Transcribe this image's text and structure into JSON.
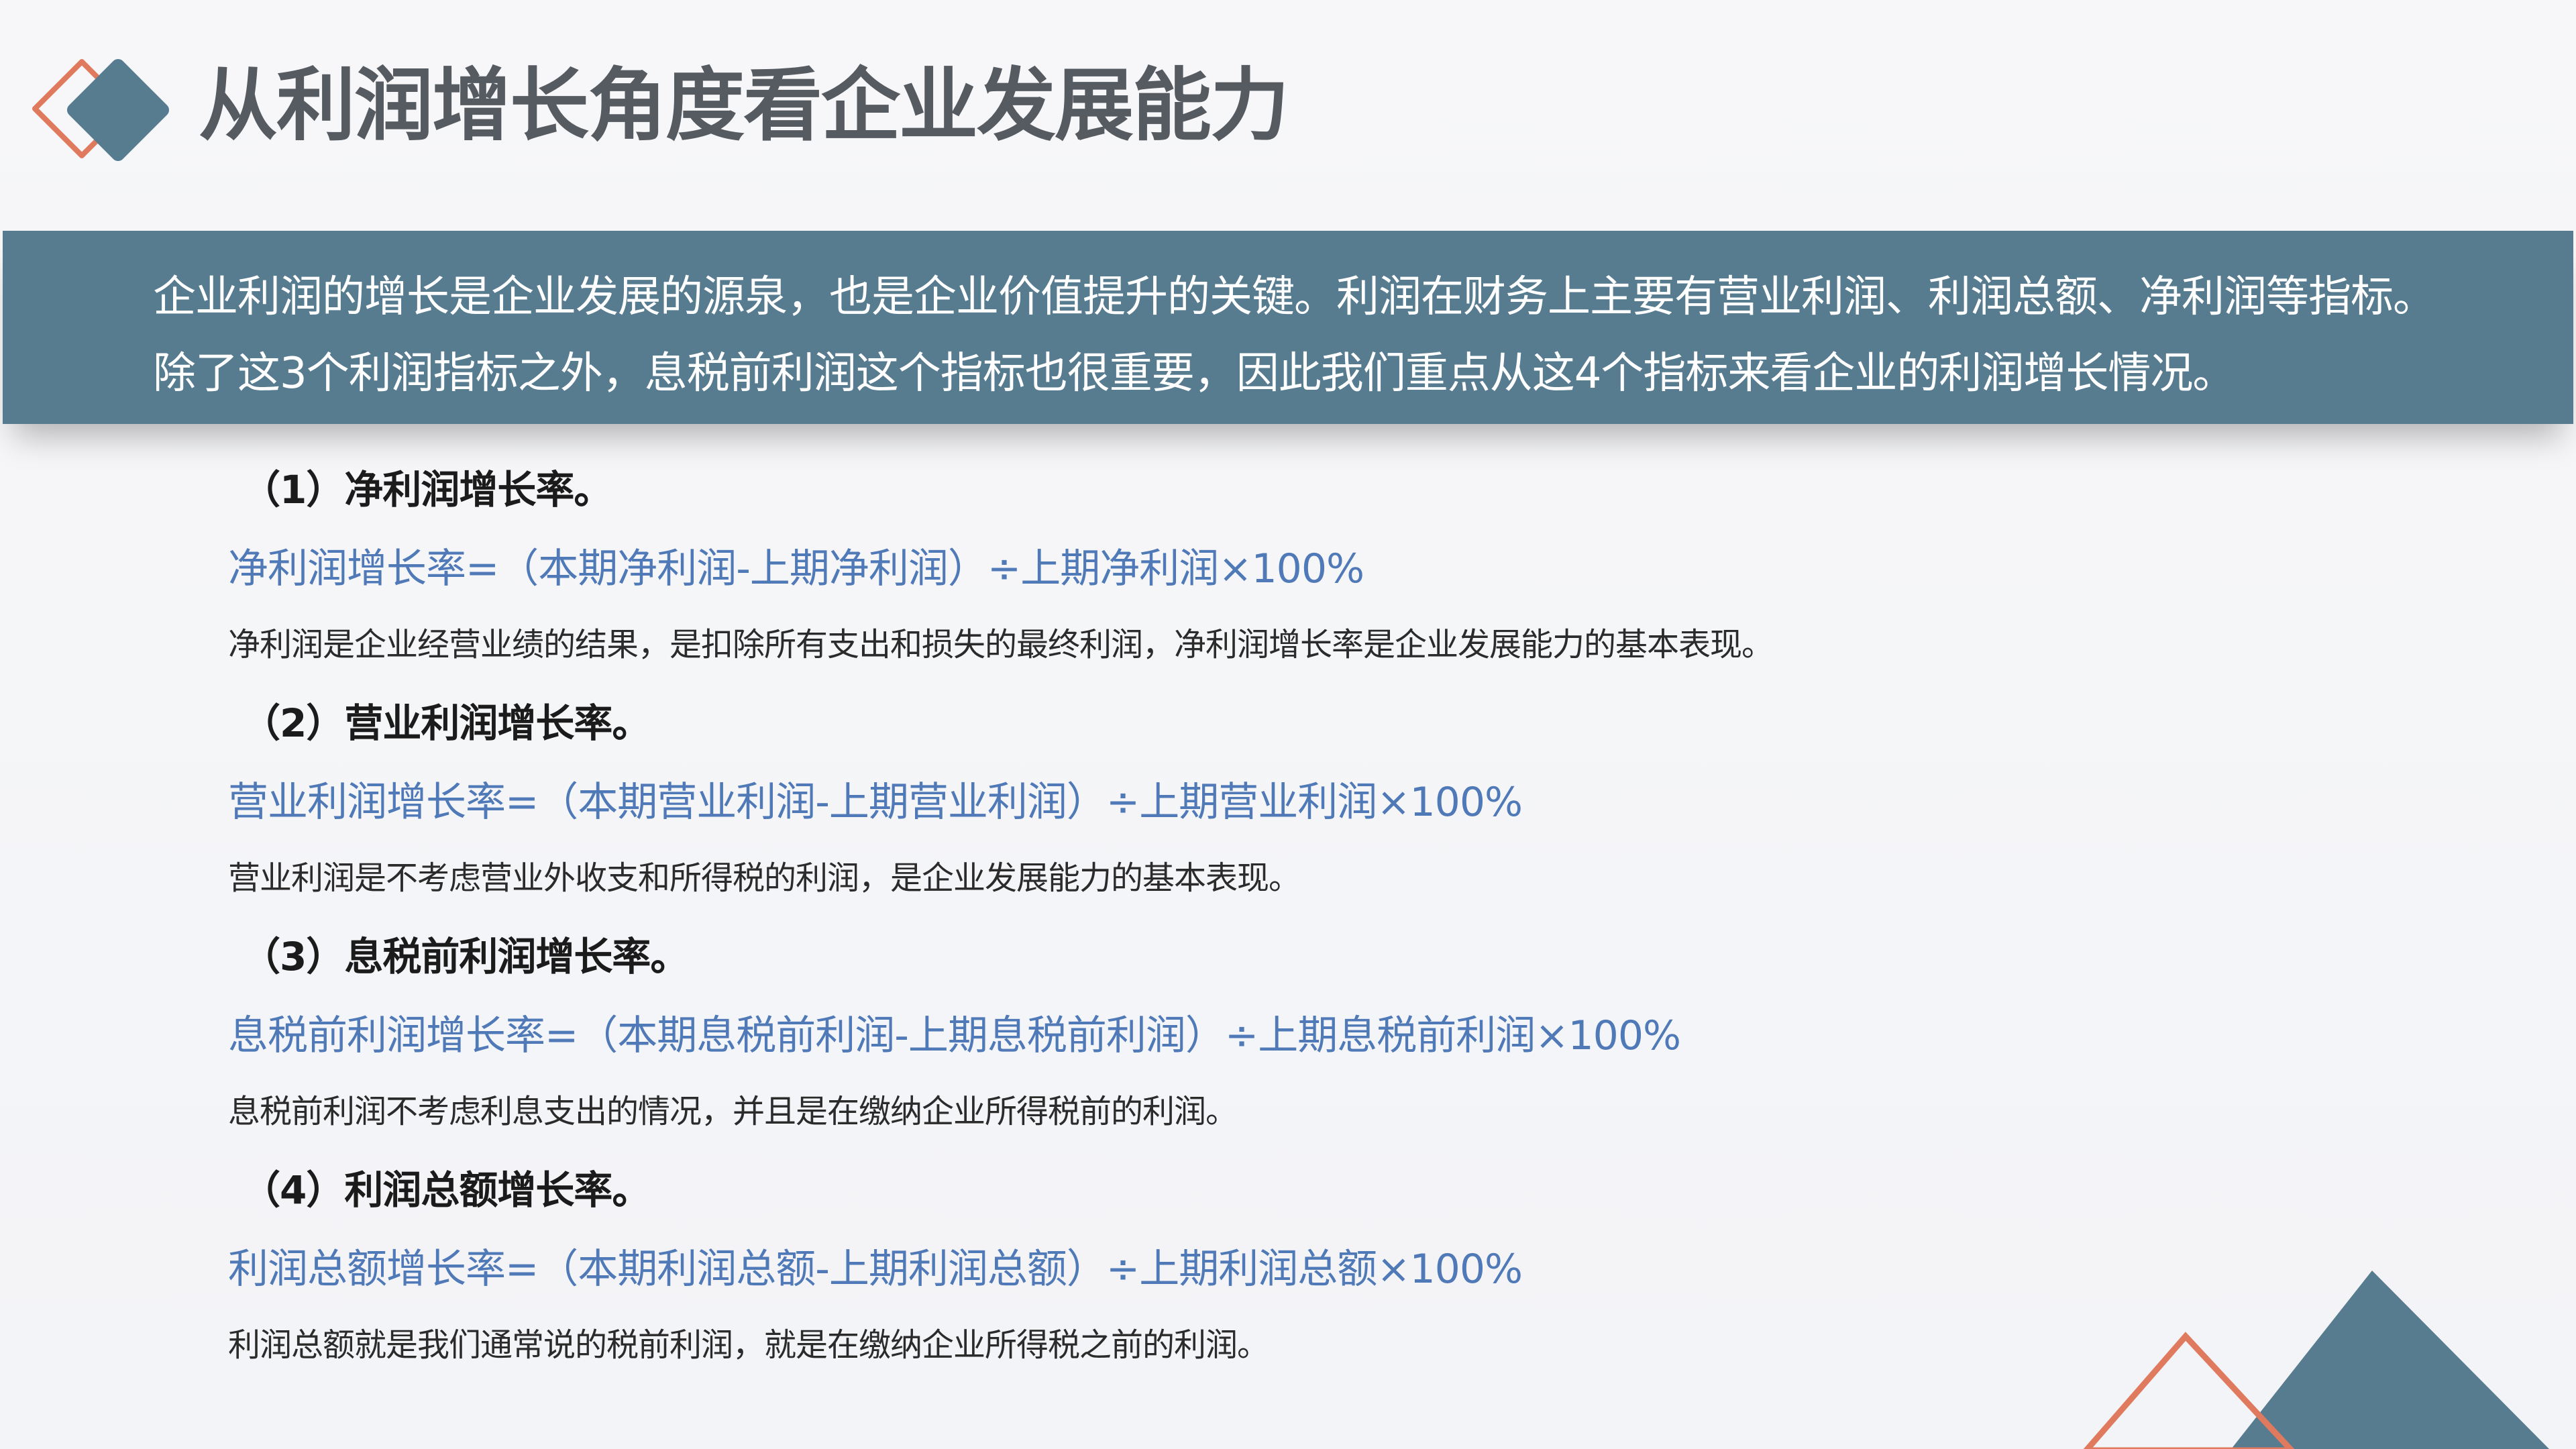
{
  "title": "从利润增长角度看企业发展能力",
  "intro": "企业利润的增长是企业发展的源泉，也是企业价值提升的关键。利润在财务上主要有营业利润、利润总额、净利润等指标。除了这3个利润指标之外，息税前利润这个指标也很重要，因此我们重点从这4个指标来看企业的利润增长情况。",
  "metrics": [
    {
      "heading": "（1）净利润增长率。",
      "formula": "净利润增长率=（本期净利润-上期净利润）÷上期净利润×100%",
      "description": "净利润是企业经营业绩的结果，是扣除所有支出和损失的最终利润，净利润增长率是企业发展能力的基本表现。"
    },
    {
      "heading": "（2）营业利润增长率。",
      "formula": "营业利润增长率=（本期营业利润-上期营业利润）÷上期营业利润×100%",
      "description": "营业利润是不考虑营业外收支和所得税的利润，是企业发展能力的基本表现。"
    },
    {
      "heading": "（3）息税前利润增长率。",
      "formula": "息税前利润增长率=（本期息税前利润-上期息税前利润）÷上期息税前利润×100%",
      "description": "息税前利润不考虑利息支出的情况，并且是在缴纳企业所得税前的利润。"
    },
    {
      "heading": "（4）利润总额增长率。",
      "formula": "利润总额增长率=（本期利润总额-上期利润总额）÷上期利润总额×100%",
      "description": "利润总额就是我们通常说的税前利润，就是在缴纳企业所得税之前的利润。"
    }
  ],
  "colors": {
    "accent_blue": "#577b8f",
    "accent_orange": "#e07a5f",
    "formula_blue": "#4f79b7",
    "title_gray": "#555b61"
  }
}
